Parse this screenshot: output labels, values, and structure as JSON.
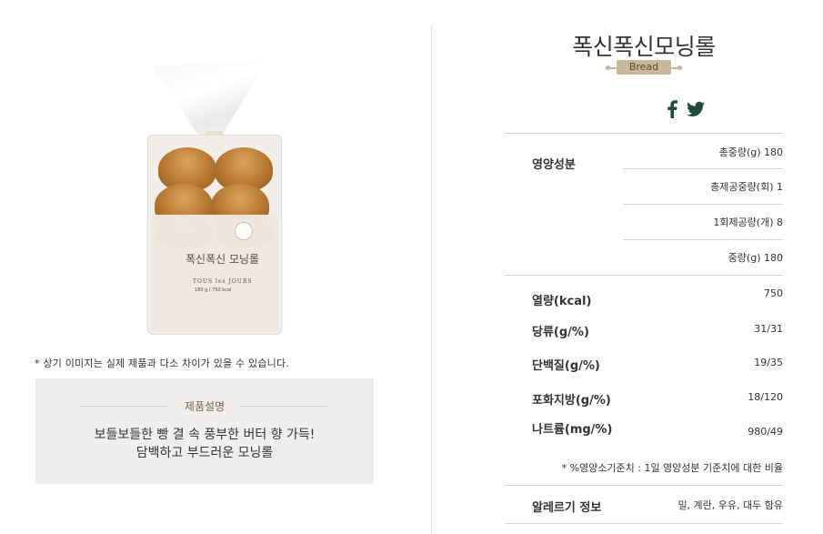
{
  "product": {
    "title": "폭신폭신모닝롤",
    "category": "Bread",
    "image_package_name": "폭신폭신 모닝롤",
    "image_package_brand": "TOUS les JOURS",
    "image_package_weight": "180 g / 750 kcal"
  },
  "left": {
    "disclaimer": "* 상기 이미지는 실제 제품과 다소 차이가 있을 수 있습니다.",
    "description_title": "제품설명",
    "description_line1": "보들보들한 빵 결 속 풍부한 버터 향 가득!",
    "description_line2": "담백하고 부드러운 모닝롤"
  },
  "share": {
    "facebook": "f"
  },
  "nutrition": {
    "section_label": "영양성분",
    "basic": [
      {
        "value": "총중량(g) 180"
      },
      {
        "value": "총제공중량(회) 1"
      },
      {
        "value": "1회제공량(개) 8"
      },
      {
        "value": "중량(g) 180"
      }
    ],
    "items": [
      {
        "label": "열량(kcal)",
        "value": "750"
      },
      {
        "label": "당류(g/%)",
        "value": "31/31"
      },
      {
        "label": "단백질(g/%)",
        "value": "19/35"
      },
      {
        "label": "포화지방(g/%)",
        "value": "18/120"
      },
      {
        "label": "나트륨(mg/%)",
        "value": "980/49"
      }
    ],
    "footnote": "* %영양소기준치 : 1일 영양성분 기준치에 대한 비율"
  },
  "allergy": {
    "label": "알레르기 정보",
    "value": "밀, 계란, 우유, 대두 함유"
  },
  "colors": {
    "accent": "#c9b79c",
    "social_icon": "#1f4a3c",
    "desc_bg": "#f0efed"
  }
}
